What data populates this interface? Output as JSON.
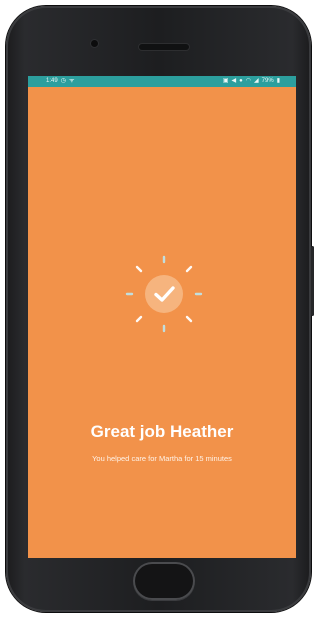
{
  "status_bar": {
    "time": "1:49",
    "battery": "79%",
    "bg_color": "#2c9f9e",
    "left_icons": [
      "clock-icon",
      "signal-activity-icon"
    ],
    "right_icons": [
      "vibrate-icon",
      "mute-icon",
      "location-icon",
      "wifi-icon",
      "cell-signal-icon",
      "battery-icon"
    ]
  },
  "screen": {
    "bg_color": "#f2924a",
    "icon": "checkmark-icon",
    "title": "Great job Heather",
    "subtitle": "You helped care for Martha for 15 minutes"
  }
}
